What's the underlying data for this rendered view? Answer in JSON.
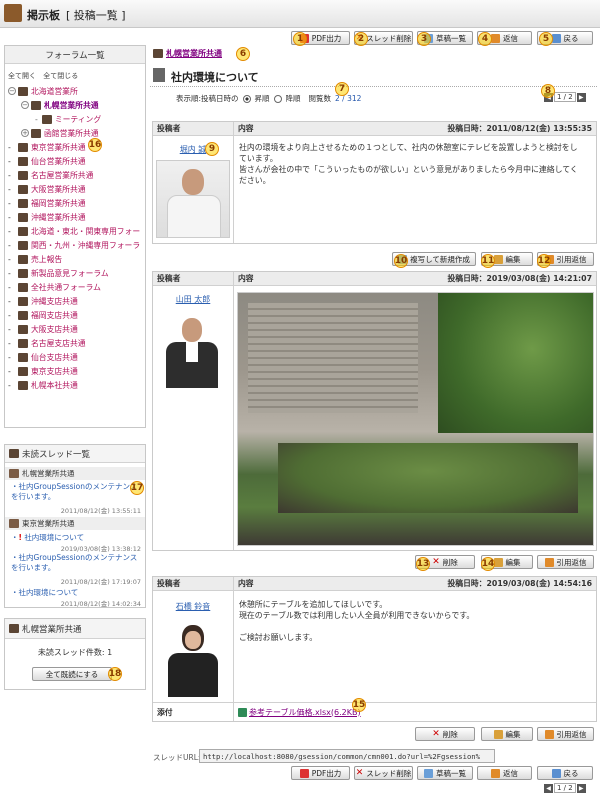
{
  "app": {
    "title": "掲示板",
    "subtitle": "[ 投稿一覧 ]"
  },
  "toolbar": {
    "pdf": "PDF出力",
    "thread_delete": "スレッド削除",
    "draft_list": "草稿一覧",
    "reply": "返信",
    "back": "戻る"
  },
  "markers": [
    "1",
    "2",
    "3",
    "4",
    "5",
    "6",
    "7",
    "8",
    "9",
    "10",
    "11",
    "12",
    "13",
    "14",
    "15",
    "16",
    "17",
    "18"
  ],
  "forum_list": {
    "title": "フォーラム一覧",
    "expand_all": "全て開く",
    "collapse_all": "全て閉じる",
    "items": [
      "北海道営業所",
      "札幌営業所共通",
      "ミーティング",
      "函館営業所共通",
      "東京営業所共通",
      "仙台営業所共通",
      "名古屋営業所共通",
      "大阪営業所共通",
      "福岡営業所共通",
      "沖縄営業所共通",
      "北海道・東北・関東専用フォー",
      "関西・九州・沖縄専用フォーラ",
      "売上報告",
      "新製品意見フォーラム",
      "全社共通フォーラム",
      "沖縄支店共通",
      "福岡支店共通",
      "大阪支店共通",
      "名古屋支店共通",
      "仙台支店共通",
      "東京支店共通",
      "札幌本社共通"
    ]
  },
  "unread": {
    "title": "未読スレッド一覧",
    "groups": [
      {
        "forum": "札幌営業所共通",
        "threads": [
          {
            "title": "社内GroupSessionのメンテナンスを行います。",
            "date": "2011/08/12(金) 13:55:11"
          }
        ]
      },
      {
        "forum": "東京営業所共通",
        "threads": [
          {
            "title": "社内環境について",
            "date": "2019/03/08(金) 13:38:12"
          },
          {
            "title": "社内GroupSessionのメンテナンスを行います。",
            "date": "2011/08/12(金) 17:19:07"
          },
          {
            "title": "社内環境について",
            "date": "2011/08/12(金) 14:02:34"
          }
        ]
      }
    ]
  },
  "forum_box": {
    "title": "札幌営業所共通",
    "count_label": "未読スレッド件数: 1",
    "mark_all": "全て既読にする"
  },
  "thread": {
    "forum": "札幌営業所共通",
    "title": "社内環境について",
    "order_label": "表示順:投稿日時の",
    "asc": "昇順",
    "desc": "降順",
    "views_label": "閲覧数",
    "views": "2 / 312",
    "page": "1 / 2"
  },
  "post_headers": {
    "author": "投稿者",
    "content": "内容"
  },
  "posts": [
    {
      "author": "堀内 誠",
      "date": "投稿日時：2011/08/12(金) 13:55:35",
      "lines": [
        "社内の環境をより向上させるための１つとして、社内の休憩室にテレビを設置しようと検討をし",
        "ています。",
        "皆さんが会社の中で「こういったものが欲しい」という意見がありましたら今月中に連絡してく",
        "ださい。"
      ],
      "actions": [
        "複写して新規作成",
        "編集",
        "引用返信"
      ]
    },
    {
      "author": "山田 太郎",
      "date": "投稿日時：2019/03/08(金) 14:21:07",
      "actions": [
        "削除",
        "編集",
        "引用返信"
      ]
    },
    {
      "author": "石橋 鈴音",
      "date": "投稿日時：2019/03/08(金) 14:54:16",
      "lines": [
        "休憩所にテーブルを追加してほしいです。",
        "現在のテーブル数では利用したい人全員が利用できないからです。",
        "",
        "ご検討お願いします。"
      ],
      "attach_label": "添付",
      "attachment": "参考テーブル価格.xlsx(6.2KB)",
      "actions": [
        "削除",
        "編集",
        "引用返信"
      ]
    }
  ],
  "thread_url": {
    "label": "スレッドURL:",
    "value": "http://localhost:8080/gsession/common/cmn001.do?url=%2Fgsession%"
  },
  "colors": {
    "accent": "#e28a00",
    "link": "#2b5fb0",
    "forum": "#b0125b"
  }
}
